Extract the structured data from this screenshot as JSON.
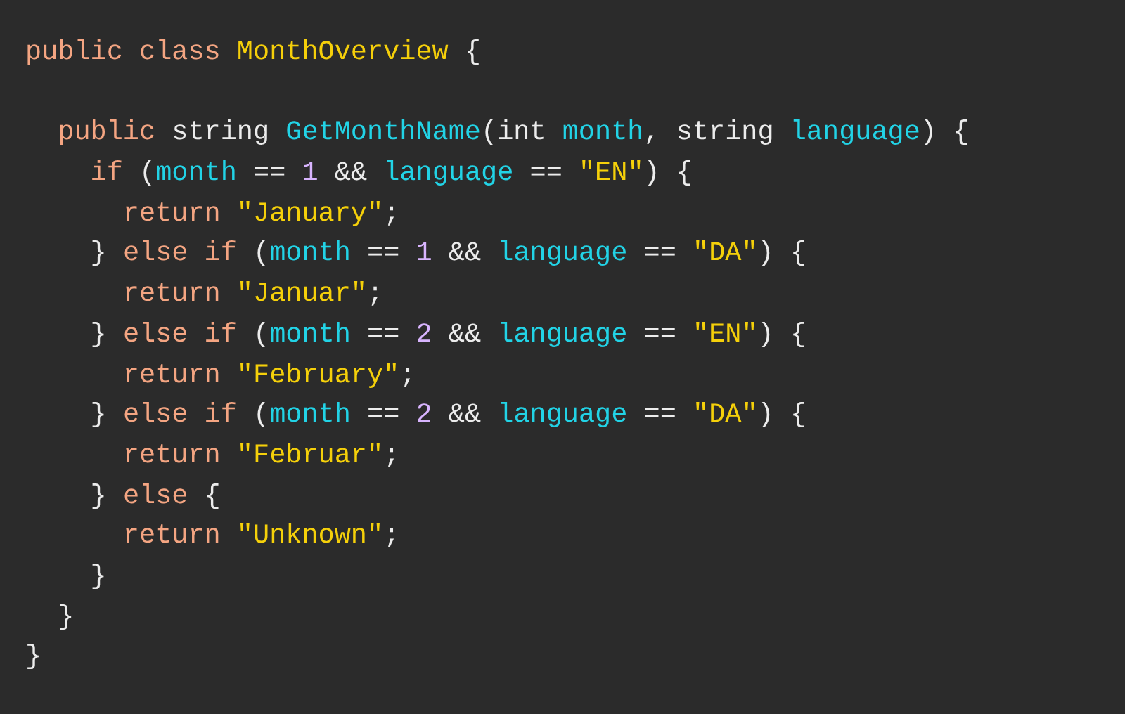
{
  "code_lines": [
    {
      "kind": "code",
      "tokens": [
        {
          "text": "public class ",
          "kind": "keyword"
        },
        {
          "text": "MonthOverview",
          "kind": "type"
        },
        {
          "text": " {",
          "kind": "plain"
        }
      ]
    },
    {
      "kind": "blank"
    },
    {
      "kind": "code",
      "tokens": [
        {
          "text": "  public ",
          "kind": "keyword"
        },
        {
          "text": "string ",
          "kind": "plain"
        },
        {
          "text": "GetMonthName",
          "kind": "name"
        },
        {
          "text": "(int ",
          "kind": "plain"
        },
        {
          "text": "month",
          "kind": "name"
        },
        {
          "text": ", string ",
          "kind": "plain"
        },
        {
          "text": "language",
          "kind": "name"
        },
        {
          "text": ") {",
          "kind": "plain"
        }
      ]
    },
    {
      "kind": "code",
      "tokens": [
        {
          "text": "    if ",
          "kind": "keyword"
        },
        {
          "text": "(",
          "kind": "plain"
        },
        {
          "text": "month",
          "kind": "name"
        },
        {
          "text": " == ",
          "kind": "plain"
        },
        {
          "text": "1",
          "kind": "number"
        },
        {
          "text": " && ",
          "kind": "plain"
        },
        {
          "text": "language",
          "kind": "name"
        },
        {
          "text": " == ",
          "kind": "plain"
        },
        {
          "text": "\"EN\"",
          "kind": "string"
        },
        {
          "text": ") {",
          "kind": "plain"
        }
      ]
    },
    {
      "kind": "code",
      "tokens": [
        {
          "text": "      return ",
          "kind": "keyword"
        },
        {
          "text": "\"January\"",
          "kind": "string"
        },
        {
          "text": ";",
          "kind": "plain"
        }
      ]
    },
    {
      "kind": "code",
      "tokens": [
        {
          "text": "    } ",
          "kind": "plain"
        },
        {
          "text": "else if ",
          "kind": "keyword"
        },
        {
          "text": "(",
          "kind": "plain"
        },
        {
          "text": "month",
          "kind": "name"
        },
        {
          "text": " == ",
          "kind": "plain"
        },
        {
          "text": "1",
          "kind": "number"
        },
        {
          "text": " && ",
          "kind": "plain"
        },
        {
          "text": "language",
          "kind": "name"
        },
        {
          "text": " == ",
          "kind": "plain"
        },
        {
          "text": "\"DA\"",
          "kind": "string"
        },
        {
          "text": ") {",
          "kind": "plain"
        }
      ]
    },
    {
      "kind": "code",
      "tokens": [
        {
          "text": "      return ",
          "kind": "keyword"
        },
        {
          "text": "\"Januar\"",
          "kind": "string"
        },
        {
          "text": ";",
          "kind": "plain"
        }
      ]
    },
    {
      "kind": "code",
      "tokens": [
        {
          "text": "    } ",
          "kind": "plain"
        },
        {
          "text": "else if ",
          "kind": "keyword"
        },
        {
          "text": "(",
          "kind": "plain"
        },
        {
          "text": "month",
          "kind": "name"
        },
        {
          "text": " == ",
          "kind": "plain"
        },
        {
          "text": "2",
          "kind": "number"
        },
        {
          "text": " && ",
          "kind": "plain"
        },
        {
          "text": "language",
          "kind": "name"
        },
        {
          "text": " == ",
          "kind": "plain"
        },
        {
          "text": "\"EN\"",
          "kind": "string"
        },
        {
          "text": ") {",
          "kind": "plain"
        }
      ]
    },
    {
      "kind": "code",
      "tokens": [
        {
          "text": "      return ",
          "kind": "keyword"
        },
        {
          "text": "\"February\"",
          "kind": "string"
        },
        {
          "text": ";",
          "kind": "plain"
        }
      ]
    },
    {
      "kind": "code",
      "tokens": [
        {
          "text": "    } ",
          "kind": "plain"
        },
        {
          "text": "else if ",
          "kind": "keyword"
        },
        {
          "text": "(",
          "kind": "plain"
        },
        {
          "text": "month",
          "kind": "name"
        },
        {
          "text": " == ",
          "kind": "plain"
        },
        {
          "text": "2",
          "kind": "number"
        },
        {
          "text": " && ",
          "kind": "plain"
        },
        {
          "text": "language",
          "kind": "name"
        },
        {
          "text": " == ",
          "kind": "plain"
        },
        {
          "text": "\"DA\"",
          "kind": "string"
        },
        {
          "text": ") {",
          "kind": "plain"
        }
      ]
    },
    {
      "kind": "code",
      "tokens": [
        {
          "text": "      return ",
          "kind": "keyword"
        },
        {
          "text": "\"Februar\"",
          "kind": "string"
        },
        {
          "text": ";",
          "kind": "plain"
        }
      ]
    },
    {
      "kind": "code",
      "tokens": [
        {
          "text": "    } ",
          "kind": "plain"
        },
        {
          "text": "else",
          "kind": "keyword"
        },
        {
          "text": " {",
          "kind": "plain"
        }
      ]
    },
    {
      "kind": "code",
      "tokens": [
        {
          "text": "      return ",
          "kind": "keyword"
        },
        {
          "text": "\"Unknown\"",
          "kind": "string"
        },
        {
          "text": ";",
          "kind": "plain"
        }
      ]
    },
    {
      "kind": "code",
      "tokens": [
        {
          "text": "    }",
          "kind": "plain"
        }
      ]
    },
    {
      "kind": "code",
      "tokens": [
        {
          "text": "  }",
          "kind": "plain"
        }
      ]
    },
    {
      "kind": "code",
      "tokens": [
        {
          "text": "}",
          "kind": "plain"
        }
      ]
    }
  ]
}
